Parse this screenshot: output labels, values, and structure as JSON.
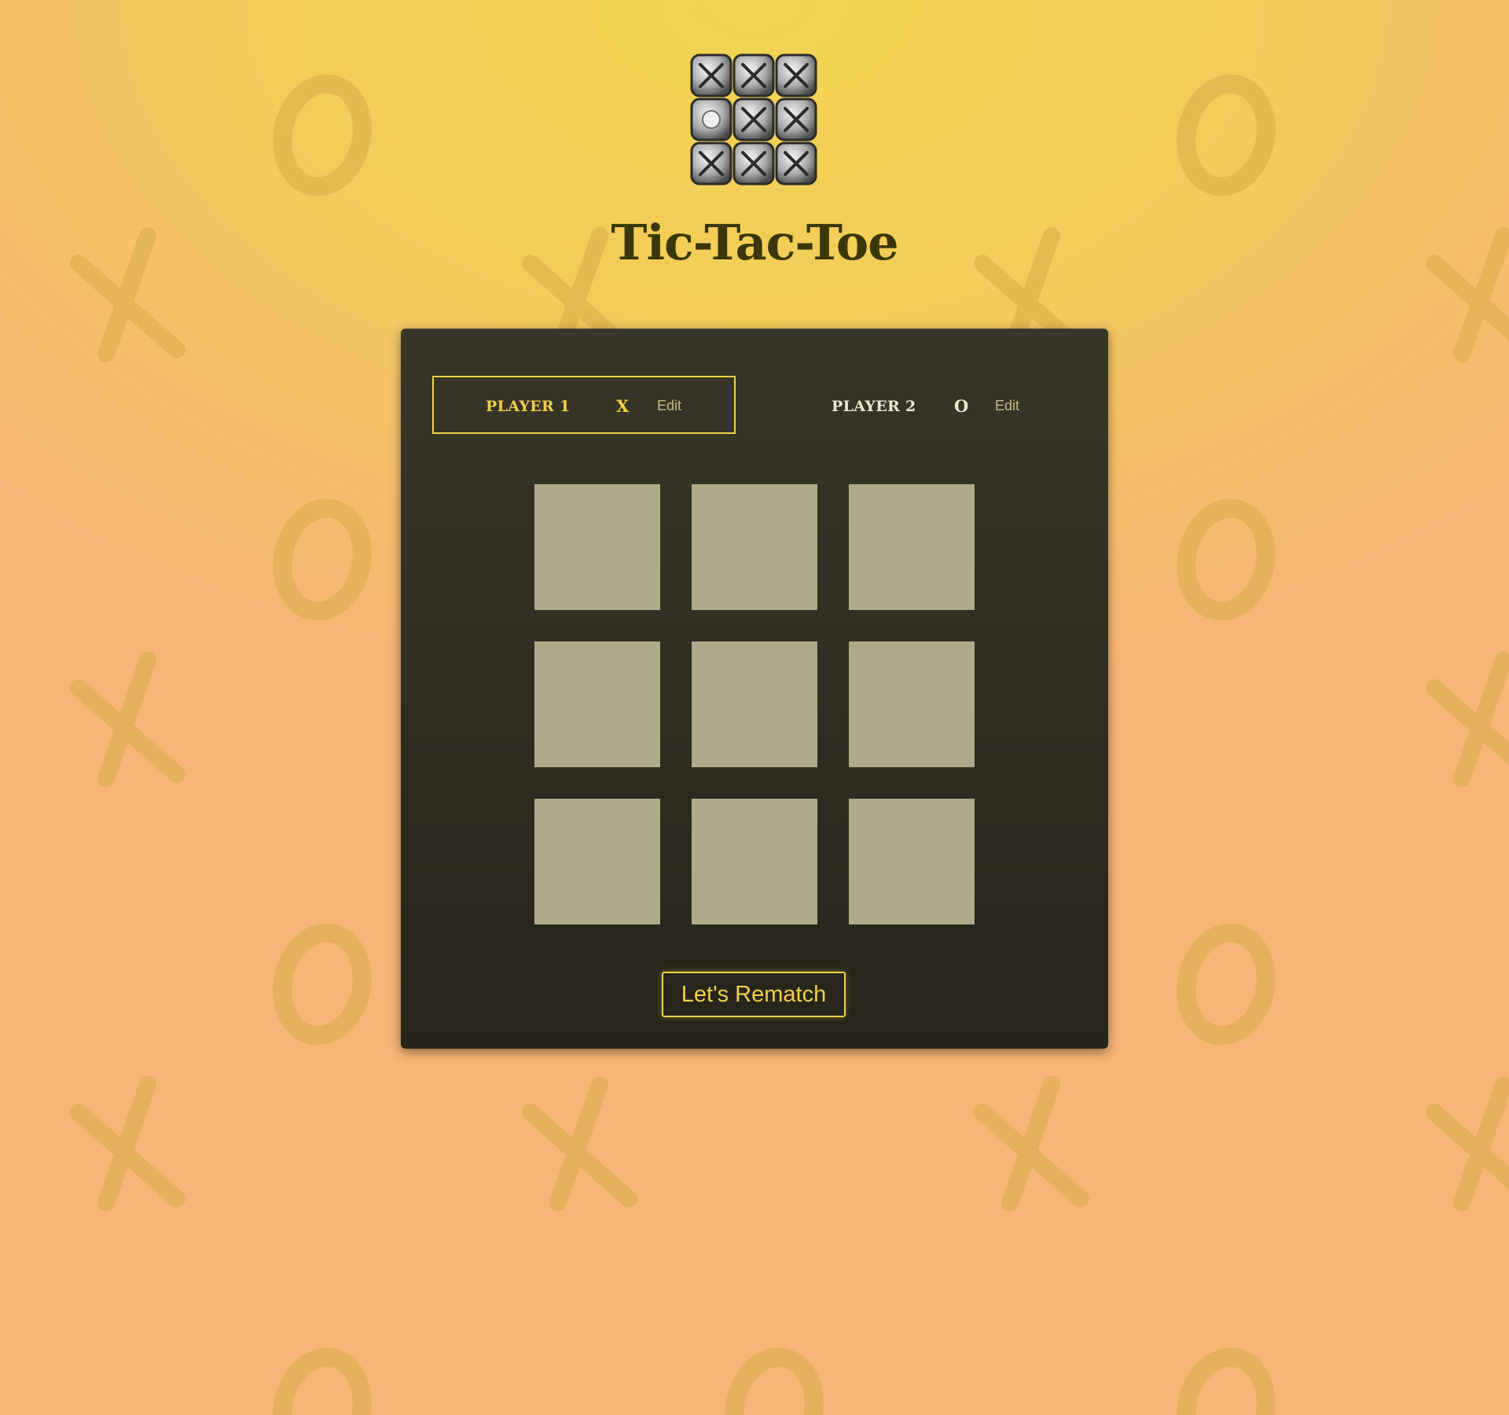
{
  "app": {
    "title": "Tic-Tac-Toe",
    "logo_icon": "tic-tac-toe-logo-icon"
  },
  "players": [
    {
      "name": "Player 1",
      "symbol": "X",
      "edit_label": "Edit",
      "active": true
    },
    {
      "name": "Player 2",
      "symbol": "O",
      "edit_label": "Edit",
      "active": false
    }
  ],
  "board": {
    "cells": [
      "",
      "",
      "",
      "",
      "",
      "",
      "",
      "",
      ""
    ]
  },
  "rematch_label": "Let's Rematch",
  "colors": {
    "accent": "#f2d04a",
    "panel": "#2f2d20",
    "cell": "#aeaa8b",
    "title": "#3a3707",
    "background_top": "#f1d450",
    "background_bottom": "#f7b576",
    "pattern": "#d8ac4a"
  },
  "background_pattern": {
    "icons": [
      "x-pattern-icon",
      "o-pattern-icon"
    ]
  }
}
